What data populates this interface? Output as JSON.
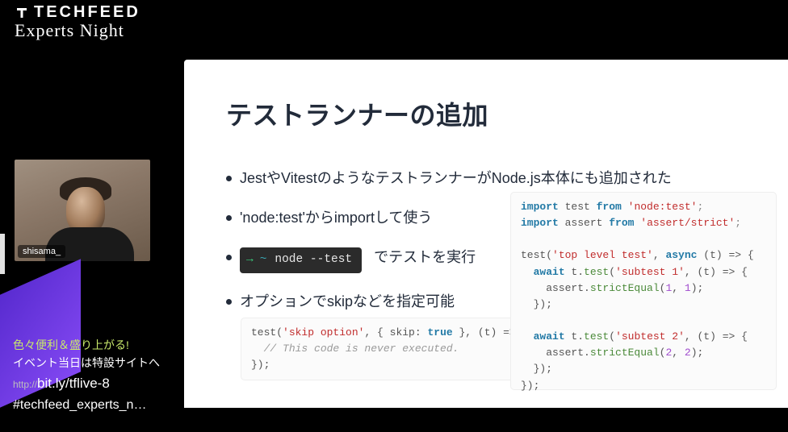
{
  "brand": {
    "name": "TECHFEED",
    "subtitle": "Experts Night"
  },
  "webcam": {
    "name": "shisama_"
  },
  "promo": {
    "line1": "色々便利＆盛り上がる!",
    "line2": "イベント当日は特設サイトへ",
    "url_proto": "http://",
    "url_rest": "bit.ly/tflive-8",
    "hashtag": "#techfeed_experts_n…"
  },
  "slide": {
    "title": "テストランナーの追加",
    "bullets": {
      "b1": "JestやVitestのようなテストランナーがNode.js本体にも追加された",
      "b2": "'node:test'からimportして使う",
      "b3_term_cmd": "node --test",
      "b3_suffix": "でテストを実行",
      "b4": "オプションでskipなどを指定可能"
    },
    "code_left": {
      "l1a": "test(",
      "l1_str": "'skip option'",
      "l1b": ", { ",
      "l1_key": "skip",
      "l1c": ": ",
      "l1_bool": "true",
      "l1d": " }, (t) => {",
      "l2": "// This code is never executed.",
      "l3": "});"
    },
    "code_right": {
      "r1a": "import",
      "r1b": " test ",
      "r1c": "from",
      "r1d": " ",
      "r1_str": "'node:test'",
      "r1e": ";",
      "r2a": "import",
      "r2b": " assert ",
      "r2c": "from",
      "r2d": " ",
      "r2_str": "'assert/strict'",
      "r2e": ";",
      "r4a": "test(",
      "r4_str": "'top level test'",
      "r4b": ", ",
      "r4_async": "async",
      "r4c": " (t) => {",
      "r5a": "  ",
      "r5_await": "await",
      "r5b": " t.",
      "r5_fn": "test",
      "r5c": "(",
      "r5_str": "'subtest 1'",
      "r5d": ", (t) => {",
      "r6a": "    assert.",
      "r6_fn": "strictEqual",
      "r6b": "(",
      "r6_n1": "1",
      "r6c": ", ",
      "r6_n2": "1",
      "r6d": ");",
      "r7": "  });",
      "r9a": "  ",
      "r9_await": "await",
      "r9b": " t.",
      "r9_fn": "test",
      "r9c": "(",
      "r9_str": "'subtest 2'",
      "r9d": ", (t) => {",
      "r10a": "    assert.",
      "r10_fn": "strictEqual",
      "r10b": "(",
      "r10_n1": "2",
      "r10c": ", ",
      "r10_n2": "2",
      "r10d": ");",
      "r11": "  });",
      "r12": "});"
    }
  }
}
